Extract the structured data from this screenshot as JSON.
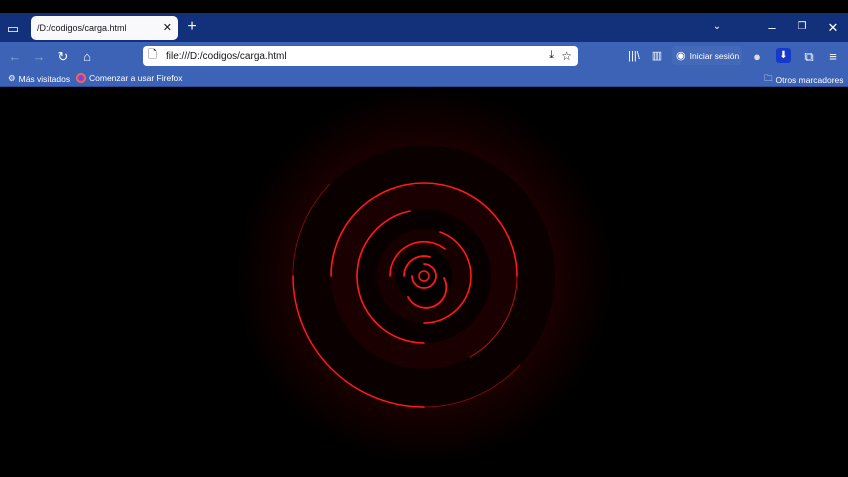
{
  "tab": {
    "title": "/D:/codigos/carga.html"
  },
  "url": "file:///D:/codigos/carga.html",
  "toolbar": {
    "signin_label": "Iniciar sesión"
  },
  "bookmarks": {
    "most_visited": "Más visitados",
    "get_started": "Comenzar a usar Firefox",
    "other": "Otros marcadores"
  },
  "colors": {
    "tabbar": "#13307a",
    "toolbar": "#3c63b5",
    "ring": "#ff1a1a"
  }
}
